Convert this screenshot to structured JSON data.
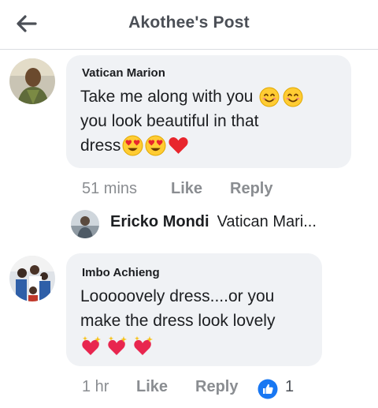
{
  "header": {
    "title": "Akothee's Post",
    "back_icon": "back-arrow-icon"
  },
  "comments": [
    {
      "author": "Vatican Marion",
      "lines": [
        "Take me along with you",
        "you look beautiful in that",
        "dress"
      ],
      "time": "51 mins",
      "like_label": "Like",
      "reply_label": "Reply"
    },
    {
      "author": "Imbo Achieng",
      "lines": [
        "Looooovely dress....or you",
        "make the dress look lovely"
      ],
      "time": "1 hr",
      "like_label": "Like",
      "reply_label": "Reply",
      "reaction_count": "1",
      "reaction_icon": "like-reaction-icon"
    }
  ],
  "reply_preview": {
    "author": "Ericko Mondi",
    "text": "Vatican Mari..."
  },
  "colors": {
    "bubble": "#f0f2f5",
    "meta": "#8a8d91",
    "like_blue": "#1877f2"
  }
}
